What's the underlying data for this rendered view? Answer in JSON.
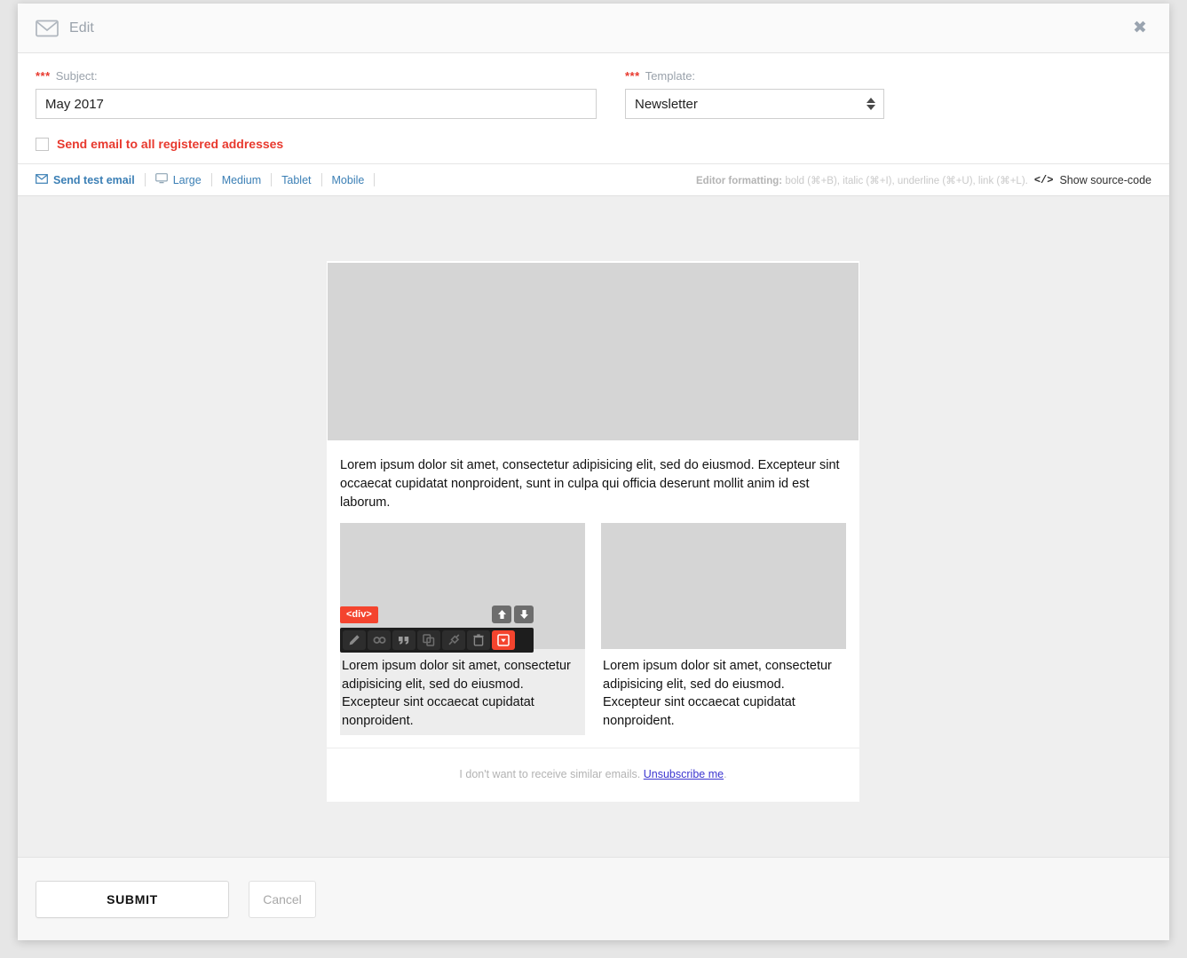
{
  "header": {
    "title": "Edit",
    "mail_icon": "envelope-icon",
    "close_icon": "close-icon"
  },
  "form": {
    "required_marker": "***",
    "subject": {
      "label": "Subject:",
      "value": "May 2017",
      "placeholder": ""
    },
    "template": {
      "label": "Template:",
      "value": "Newsletter",
      "options": [
        "Newsletter"
      ]
    },
    "send_all_checkbox": {
      "label": "Send email to all registered addresses",
      "checked": false
    }
  },
  "editor_toolbar": {
    "send_test_email": "Send test email",
    "send_test_icon": "envelope-icon",
    "screen_icon": "monitor-icon",
    "sizes": [
      "Large",
      "Medium",
      "Tablet",
      "Mobile"
    ],
    "formatting_label": "Editor formatting:",
    "formatting_hint": " bold (⌘+B), italic (⌘+I), underline (⌘+U), link (⌘+L).",
    "code_icon": "</>",
    "show_source": "Show source-code"
  },
  "email": {
    "hero_image": "image-placeholder",
    "lead_paragraph": "Lorem ipsum dolor sit amet, consectetur adipisicing elit, sed do eiusmod. Excepteur sint occaecat cupidatat nonproident, sunt in culpa qui officia deserunt mollit anim id est laborum.",
    "columns": [
      {
        "image": "image-placeholder",
        "text": "Lorem ipsum dolor sit amet, consectetur adipisicing elit, sed do eiusmod. Excepteur sint occaecat cupidatat nonproident.",
        "selected": true
      },
      {
        "image": "image-placeholder",
        "text": "Lorem ipsum dolor sit amet, consectetur adipisicing elit, sed do eiusmod. Excepteur sint occaecat cupidatat nonproident.",
        "selected": false
      }
    ],
    "footer_text": "I don't want to receive similar emails. ",
    "footer_link": "Unsubscribe me",
    "footer_suffix": "."
  },
  "edit_widget": {
    "tag_badge": "<div>",
    "move_up_icon": "arrow-up-icon",
    "move_down_icon": "arrow-down-icon",
    "tools": [
      {
        "name": "pencil-icon",
        "label": "Edit"
      },
      {
        "name": "link-icon",
        "label": "Link"
      },
      {
        "name": "quote-icon",
        "label": "Quote"
      },
      {
        "name": "duplicate-icon",
        "label": "Duplicate"
      },
      {
        "name": "unplug-icon",
        "label": "Unlink"
      },
      {
        "name": "trash-icon",
        "label": "Delete"
      },
      {
        "name": "collapse-box-icon",
        "label": "Collapse"
      }
    ]
  },
  "footer": {
    "submit_label": "SUBMIT",
    "cancel_label": "Cancel"
  },
  "colors": {
    "accent_red": "#f4442e",
    "required_red": "#e8392e",
    "link_blue": "#3b7fb5",
    "unsubscribe_blue": "#3b35d0",
    "placeholder_gray": "#d5d5d5",
    "canvas_gray": "#efefef"
  }
}
